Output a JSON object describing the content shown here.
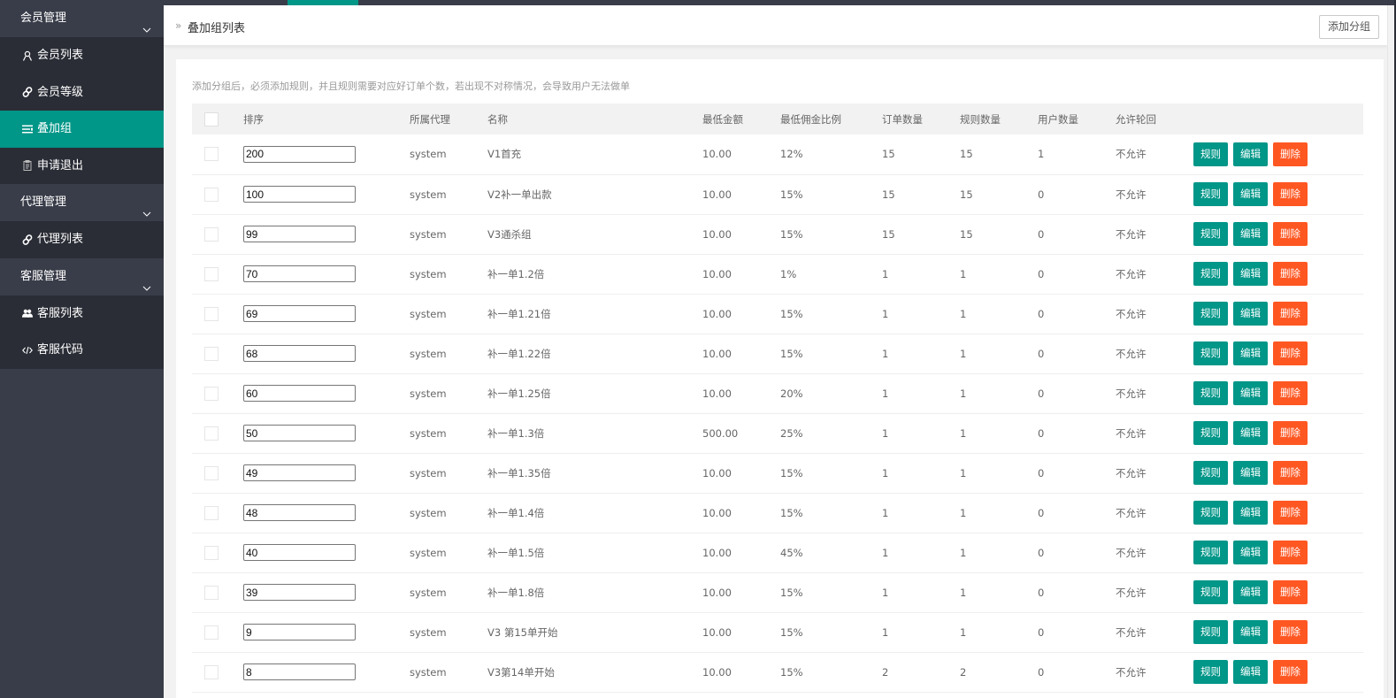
{
  "sidebar": {
    "groups": [
      {
        "title": "会员管理",
        "items": [
          {
            "label": "会员列表",
            "icon": "user-icon",
            "active": false
          },
          {
            "label": "会员等级",
            "icon": "link-icon",
            "active": false
          },
          {
            "label": "叠加组",
            "icon": "list-icon",
            "active": true
          },
          {
            "label": "申请退出",
            "icon": "clipboard-icon",
            "active": false
          }
        ]
      },
      {
        "title": "代理管理",
        "items": [
          {
            "label": "代理列表",
            "icon": "link-icon",
            "active": false
          }
        ]
      },
      {
        "title": "客服管理",
        "items": [
          {
            "label": "客服列表",
            "icon": "users-icon",
            "active": false
          },
          {
            "label": "客服代码",
            "icon": "code-icon",
            "active": false
          }
        ]
      }
    ]
  },
  "header": {
    "breadcrumb_arrow": "»",
    "title": "叠加组列表",
    "add_group_label": "添加分组"
  },
  "tip": "添加分组后，必须添加规则，并且规则需要对应好订单个数，若出现不对称情况，会导致用户无法做单",
  "table": {
    "columns": [
      "排序",
      "所属代理",
      "名称",
      "最低金额",
      "最低佣金比例",
      "订单数量",
      "规则数量",
      "用户数量",
      "允许轮回"
    ],
    "actions": {
      "rule": "规则",
      "edit": "编辑",
      "delete": "删除"
    },
    "rows": [
      {
        "sort": "200",
        "agent": "system",
        "name": "V1首充",
        "min_amount": "10.00",
        "min_commission": "12%",
        "orders": "15",
        "rules": "15",
        "users": "1",
        "cycle": "不允许"
      },
      {
        "sort": "100",
        "agent": "system",
        "name": "V2补一单出款",
        "min_amount": "10.00",
        "min_commission": "15%",
        "orders": "15",
        "rules": "15",
        "users": "0",
        "cycle": "不允许"
      },
      {
        "sort": "99",
        "agent": "system",
        "name": "V3通杀组",
        "min_amount": "10.00",
        "min_commission": "15%",
        "orders": "15",
        "rules": "15",
        "users": "0",
        "cycle": "不允许"
      },
      {
        "sort": "70",
        "agent": "system",
        "name": "补一单1.2倍",
        "min_amount": "10.00",
        "min_commission": "1%",
        "orders": "1",
        "rules": "1",
        "users": "0",
        "cycle": "不允许"
      },
      {
        "sort": "69",
        "agent": "system",
        "name": "补一单1.21倍",
        "min_amount": "10.00",
        "min_commission": "15%",
        "orders": "1",
        "rules": "1",
        "users": "0",
        "cycle": "不允许"
      },
      {
        "sort": "68",
        "agent": "system",
        "name": "补一单1.22倍",
        "min_amount": "10.00",
        "min_commission": "15%",
        "orders": "1",
        "rules": "1",
        "users": "0",
        "cycle": "不允许"
      },
      {
        "sort": "60",
        "agent": "system",
        "name": "补一单1.25倍",
        "min_amount": "10.00",
        "min_commission": "20%",
        "orders": "1",
        "rules": "1",
        "users": "0",
        "cycle": "不允许"
      },
      {
        "sort": "50",
        "agent": "system",
        "name": "补一单1.3倍",
        "min_amount": "500.00",
        "min_commission": "25%",
        "orders": "1",
        "rules": "1",
        "users": "0",
        "cycle": "不允许"
      },
      {
        "sort": "49",
        "agent": "system",
        "name": "补一单1.35倍",
        "min_amount": "10.00",
        "min_commission": "15%",
        "orders": "1",
        "rules": "1",
        "users": "0",
        "cycle": "不允许"
      },
      {
        "sort": "48",
        "agent": "system",
        "name": "补一单1.4倍",
        "min_amount": "10.00",
        "min_commission": "15%",
        "orders": "1",
        "rules": "1",
        "users": "0",
        "cycle": "不允许"
      },
      {
        "sort": "40",
        "agent": "system",
        "name": "补一单1.5倍",
        "min_amount": "10.00",
        "min_commission": "45%",
        "orders": "1",
        "rules": "1",
        "users": "0",
        "cycle": "不允许"
      },
      {
        "sort": "39",
        "agent": "system",
        "name": "补一单1.8倍",
        "min_amount": "10.00",
        "min_commission": "15%",
        "orders": "1",
        "rules": "1",
        "users": "0",
        "cycle": "不允许"
      },
      {
        "sort": "9",
        "agent": "system",
        "name": "V3 第15单开始",
        "min_amount": "10.00",
        "min_commission": "15%",
        "orders": "1",
        "rules": "1",
        "users": "0",
        "cycle": "不允许"
      },
      {
        "sort": "8",
        "agent": "system",
        "name": "V3第14单开始",
        "min_amount": "10.00",
        "min_commission": "15%",
        "orders": "2",
        "rules": "2",
        "users": "0",
        "cycle": "不允许"
      }
    ]
  },
  "colors": {
    "accent": "#009688",
    "danger": "#ff5722",
    "sidebar_bg": "#393d49",
    "sidebar_child_bg": "#2a2d36"
  }
}
